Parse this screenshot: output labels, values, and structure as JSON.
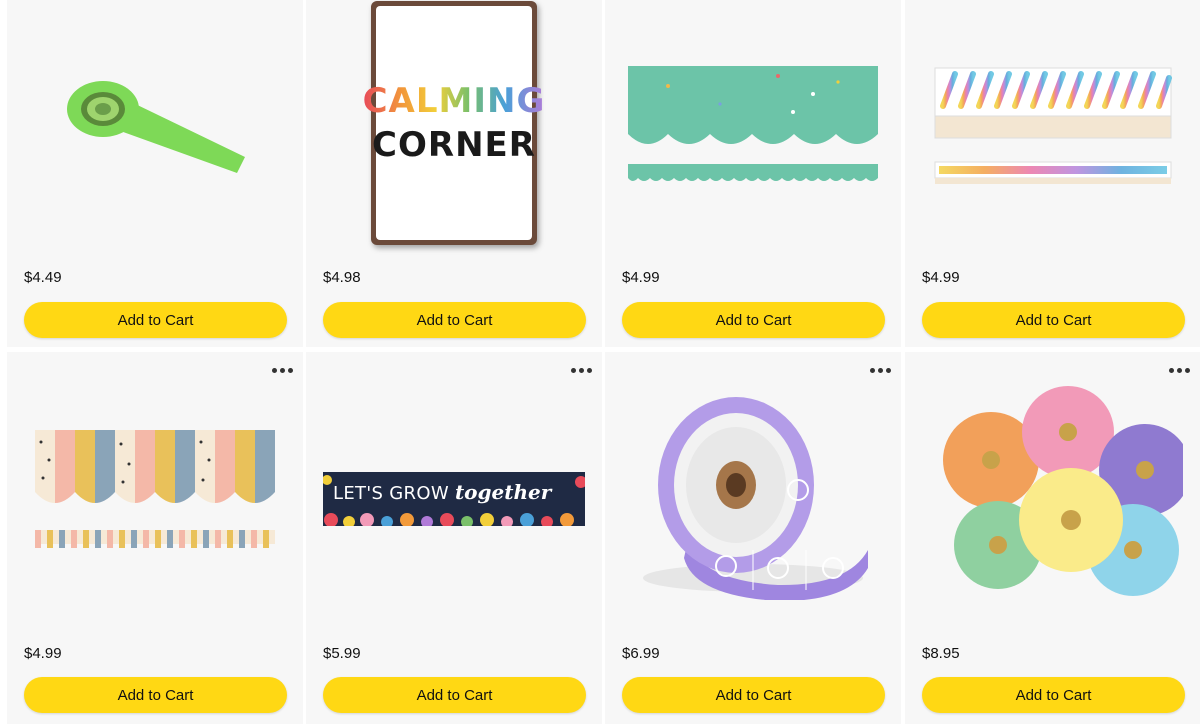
{
  "products": [
    {
      "price": "$4.49",
      "add_label": "Add to Cart",
      "image": "green-bordette-roll"
    },
    {
      "price": "$4.98",
      "add_label": "Add to Cart",
      "image": "calming-corner-sign",
      "sign_word1": "CALMING",
      "sign_word2": "CORNER"
    },
    {
      "price": "$4.99",
      "add_label": "Add to Cart",
      "image": "teal-scalloped-border"
    },
    {
      "price": "$4.99",
      "add_label": "Add to Cart",
      "image": "rainbow-brushstroke-border"
    },
    {
      "price": "$4.99",
      "add_label": "Add to Cart",
      "image": "pastel-stripe-scalloped-border"
    },
    {
      "price": "$5.99",
      "add_label": "Add to Cart",
      "image": "lets-grow-together-banner",
      "banner_text_a": "LET'S GROW ",
      "banner_text_b": "together"
    },
    {
      "price": "$6.99",
      "add_label": "Add to Cart",
      "image": "purple-smiley-ticket-roll"
    },
    {
      "price": "$8.95",
      "add_label": "Add to Cart",
      "image": "paper-flower-fans"
    }
  ],
  "colors": {
    "button": "#ffd814",
    "card_bg": "#f7f7f7",
    "text": "#111111"
  },
  "icons": {
    "more": "more-options-icon"
  }
}
